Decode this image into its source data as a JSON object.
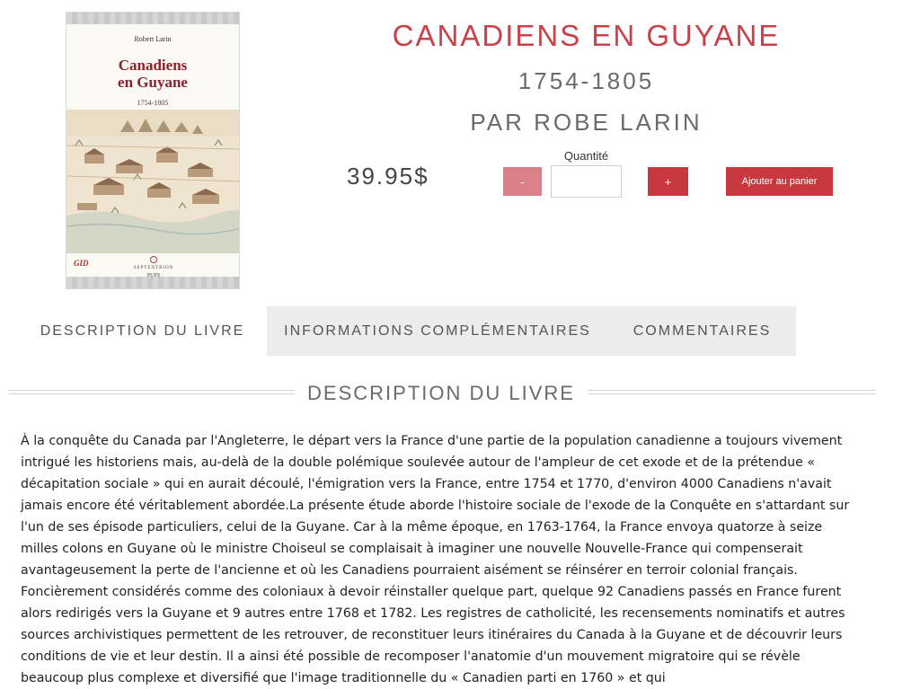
{
  "cover": {
    "author": "Robert Larin",
    "title_line1": "Canadiens",
    "title_line2": "en Guyane",
    "dates": "1754-1805",
    "logo_left": "GID",
    "publisher": "SEPTENTRION",
    "publisher2": "PUPS"
  },
  "product": {
    "title": "CANADIENS EN GUYANE",
    "dates": "1754-1805",
    "byline": "PAR ROBE LARIN",
    "price": "39.95$"
  },
  "cart": {
    "quantity_label": "Quantité",
    "quantity_value": "",
    "minus_label": "-",
    "plus_label": "+",
    "add_label": "Ajouter au panier"
  },
  "tabs": [
    {
      "label": "DESCRIPTION DU LIVRE",
      "active": true
    },
    {
      "label": "INFORMATIONS COMPLÉMENTAIRES",
      "active": false
    },
    {
      "label": "COMMENTAIRES",
      "active": false
    }
  ],
  "section": {
    "title": "DESCRIPTION DU LIVRE",
    "text": "À la conquête du Canada par l'Angleterre, le départ vers la France d'une partie de la population canadienne a toujours vivement intrigué les historiens mais, au-delà de la double polémique soulevée autour de l'ampleur de cet exode et de la prétendue « décapitation sociale » qui en aurait découlé, l'émigration vers la France, entre 1754 et 1770, d'environ 4000 Canadiens n'avait jamais encore été véritablement abordée.La présente étude aborde l'histoire sociale de l'exode de la Conquête en s'attardant sur l'un de ses épisode particuliers, celui de la Guyane. Car à la même époque, en 1763-1764, la France envoya quatorze à seize milles colons en Guyane où le ministre Choiseul se complaisait à imaginer une nouvelle Nouvelle-France qui compenserait avantageusement la perte de l'ancienne et où les Canadiens pourraient aisément se réinsérer en terroir colonial français. Foncièrement considérés comme des coloniaux à devoir réinstaller quelque part, quelque 92 Canadiens passés en France furent alors redirigés vers la Guyane et 9 autres entre 1768 et 1782. Les registres de catholicité, les recensements nominatifs et autres sources archivistiques permettent de les retrouver, de reconstituer leurs itinéraires du Canada à la Guyane et de découvrir leurs conditions de vie et leur destin. Il a ainsi été possible de recomposer l'anatomie d'un mouvement migratoire qui se révèle beaucoup plus complexe et diversifié que l'image traditionnelle du « Canadien parti en 1760 » et qui"
  }
}
